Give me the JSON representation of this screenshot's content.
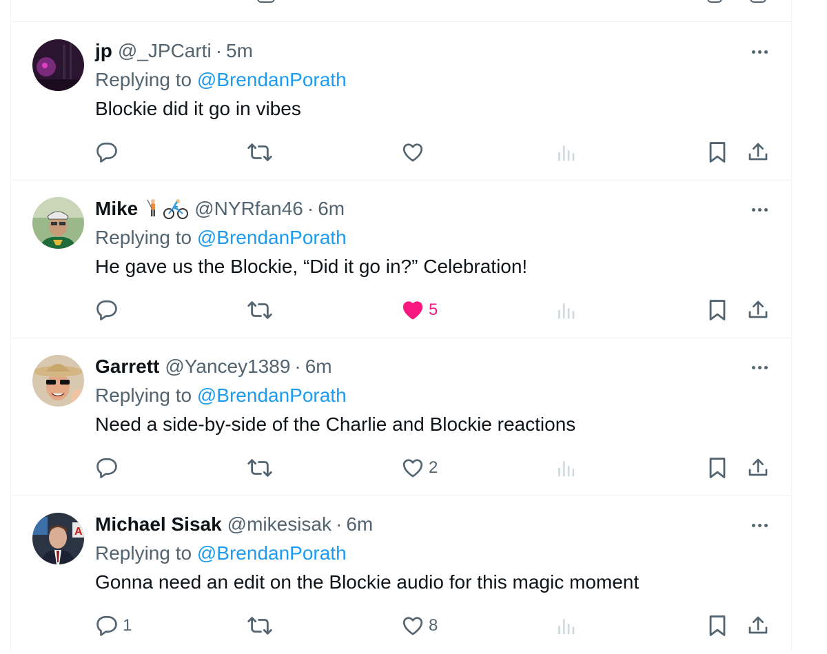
{
  "colors": {
    "text": "#0f1419",
    "secondary": "#536471",
    "link": "#1d9bf0",
    "like": "#f91880",
    "border": "#eff3f4"
  },
  "replying_to_label": "Replying to",
  "tweets": [
    {
      "name": "jp",
      "emoji": [],
      "handle": "@_JPCarti",
      "sep": "·",
      "time": "5m",
      "reply_mention": "@BrendanPorath",
      "text": "Blockie did it go in vibes",
      "reply_count": "",
      "like_count": "",
      "liked": false,
      "avatar": "dark-purple-photo"
    },
    {
      "name": "Mike",
      "emoji": [
        "golfer-emoji",
        "cyclist-emoji"
      ],
      "handle": "@NYRfan46",
      "sep": "·",
      "time": "6m",
      "reply_mention": "@BrendanPorath",
      "text": "He gave us the Blockie, “Did it go in?” Celebration!",
      "reply_count": "",
      "like_count": "5",
      "liked": true,
      "avatar": "man-with-helmet-photo"
    },
    {
      "name": "Garrett",
      "emoji": [],
      "handle": "@Yancey1389",
      "sep": "·",
      "time": "6m",
      "reply_mention": "@BrendanPorath",
      "text": "Need a side-by-side of the Charlie and Blockie reactions",
      "reply_count": "",
      "like_count": "2",
      "liked": false,
      "avatar": "man-with-hat-sunglasses-photo"
    },
    {
      "name": "Michael Sisak",
      "emoji": [],
      "handle": "@mikesisak",
      "sep": "·",
      "time": "6m",
      "reply_mention": "@BrendanPorath",
      "text": "Gonna need an edit on the Blockie audio for this magic moment",
      "reply_count": "1",
      "like_count": "8",
      "liked": false,
      "avatar": "man-in-suit-photo"
    }
  ]
}
